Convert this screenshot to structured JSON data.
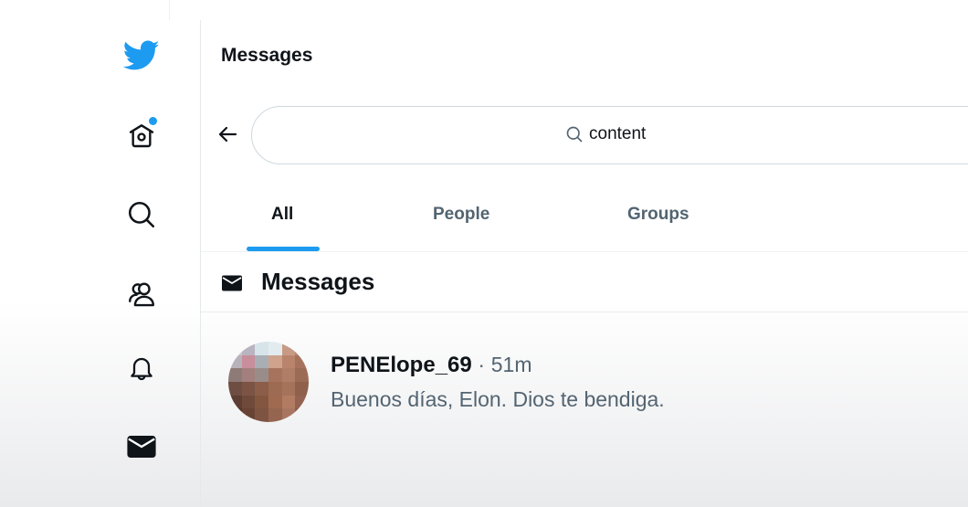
{
  "sidebar": {
    "items": [
      {
        "icon": "twitter-bird-icon",
        "label": "Twitter"
      },
      {
        "icon": "home-icon",
        "label": "Home",
        "has_notification_dot": true
      },
      {
        "icon": "search-icon",
        "label": "Explore"
      },
      {
        "icon": "communities-icon",
        "label": "Communities"
      },
      {
        "icon": "bell-icon",
        "label": "Notifications"
      },
      {
        "icon": "envelope-icon",
        "label": "Messages"
      }
    ],
    "brand_color": "#1d9bf0"
  },
  "header": {
    "title": "Messages"
  },
  "search": {
    "value": "content",
    "back_icon": "arrow-left-icon",
    "search_icon": "search-icon"
  },
  "tabs": [
    {
      "label": "All",
      "active": true
    },
    {
      "label": "People",
      "active": false
    },
    {
      "label": "Groups",
      "active": false
    }
  ],
  "section": {
    "icon": "envelope-icon",
    "title": "Messages"
  },
  "messages": [
    {
      "name": "PENElope_69",
      "separator": "·",
      "time": "51m",
      "preview": "Buenos días, Elon. Dios te bendiga.",
      "avatar": "pixelated-avatar"
    }
  ],
  "colors": {
    "accent": "#1d9bf0",
    "text_primary": "#0f1419",
    "text_secondary": "#536471"
  }
}
